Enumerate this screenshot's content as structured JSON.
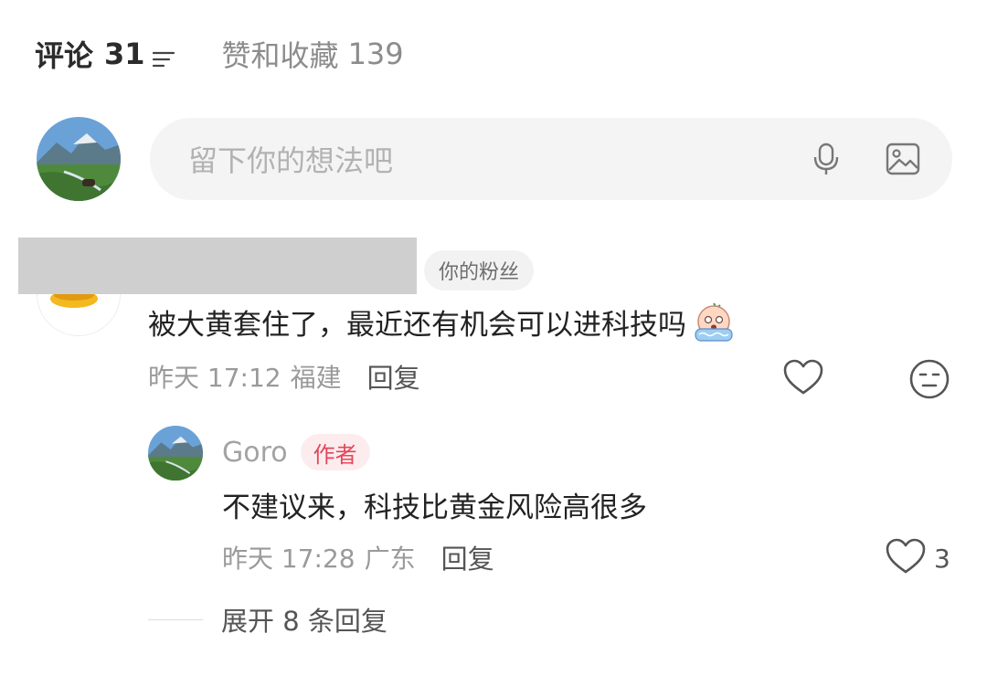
{
  "tabs": {
    "comments_label": "评论",
    "comments_count": "31",
    "likes_label": "赞和收藏",
    "likes_count": "139",
    "sort_icon": "sort-lines-icon"
  },
  "composer": {
    "placeholder": "留下你的想法吧",
    "voice_icon": "microphone-icon",
    "image_icon": "image-icon"
  },
  "comments": [
    {
      "badge": "你的粉丝",
      "text": "被大黄套住了，最近还有机会可以进科技吗",
      "emoji": "crying-face-emoji",
      "time": "昨天 17:12",
      "location": "福建",
      "reply_label": "回复",
      "replies": [
        {
          "name": "Goro",
          "badge": "作者",
          "text": "不建议来，科技比黄金风险高很多",
          "time": "昨天 17:28",
          "location": "广东",
          "reply_label": "回复",
          "likes": "3"
        }
      ],
      "expand_label": "展开 8 条回复"
    }
  ],
  "colors": {
    "author_badge_bg": "#fdecee",
    "author_badge_text": "#e2475a",
    "input_bg": "#f4f4f4",
    "secondary_text": "#9a9a9a"
  }
}
